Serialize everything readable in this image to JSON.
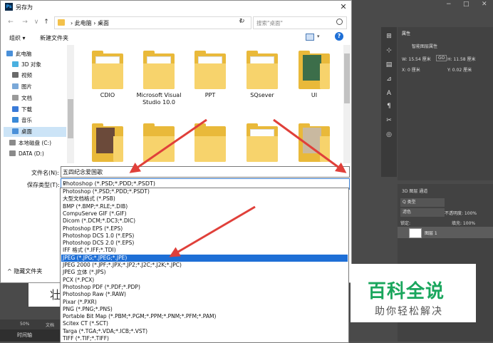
{
  "dialog": {
    "title": "另存为",
    "app_icon_text": "Ps",
    "close_glyph": "✕"
  },
  "nav": {
    "back": "←",
    "forward": "→",
    "dropdown": "∨",
    "up": "↑",
    "breadcrumb": "› 此电脑 › 桌面",
    "address_dropdown": "∨",
    "refresh": "↻",
    "search_placeholder": "搜索\"桌面\""
  },
  "toolbar": {
    "organize_label": "组织 ▾",
    "new_folder_label": "新建文件夹",
    "view_dropdown": "▾",
    "help_glyph": "?"
  },
  "sidebar": {
    "items": [
      {
        "label": "此电脑",
        "icon": "pc-icon",
        "color": "#4a90d9"
      },
      {
        "label": "3D 对象",
        "icon": "3d-objects-icon",
        "color": "#4ab0e0"
      },
      {
        "label": "视频",
        "icon": "video-icon",
        "color": "#6a6a6a"
      },
      {
        "label": "图片",
        "icon": "pictures-icon",
        "color": "#7aa8d8"
      },
      {
        "label": "文档",
        "icon": "documents-icon",
        "color": "#9a9a9a"
      },
      {
        "label": "下载",
        "icon": "downloads-icon",
        "color": "#3a7ad8"
      },
      {
        "label": "音乐",
        "icon": "music-icon",
        "color": "#3a8ad8"
      },
      {
        "label": "桌面",
        "icon": "desktop-icon",
        "color": "#4a90d9"
      },
      {
        "label": "本地磁盘 (C:)",
        "icon": "drive-icon",
        "color": "#8a8a8a"
      },
      {
        "label": "DATA (D:)",
        "icon": "drive-icon",
        "color": "#8a8a8a"
      }
    ]
  },
  "files": [
    {
      "name": "CDIO",
      "type": "folder-paper"
    },
    {
      "name": "Microsoft Visual Studio 10.0",
      "type": "folder-paper"
    },
    {
      "name": "PPT",
      "type": "folder-paper"
    },
    {
      "name": "SQsever",
      "type": "folder-paper"
    },
    {
      "name": "UI",
      "type": "folder-photo"
    },
    {
      "name": "",
      "type": "folder-photo"
    },
    {
      "name": "",
      "type": "folder-plain"
    },
    {
      "name": "",
      "type": "folder-plain"
    },
    {
      "name": "",
      "type": "folder-paper"
    },
    {
      "name": "",
      "type": "folder-paper"
    }
  ],
  "form": {
    "filename_label": "文件名(N):",
    "filename_value": "五四纪念爱国歌",
    "type_label": "保存类型(T):",
    "type_value": "Photoshop (*.PSD;*.PDD;*.PSDT)",
    "type_dropdown": "∨",
    "hide_folders": "^ 隐藏文件夹"
  },
  "type_options": [
    "Photoshop (*.PSD;*.PDD;*.PSDT)",
    "大型文档格式 (*.PSB)",
    "BMP (*.BMP;*.RLE;*.DIB)",
    "CompuServe GIF (*.GIF)",
    "Dicom (*.DCM;*.DC3;*.DIC)",
    "Photoshop EPS (*.EPS)",
    "Photoshop DCS 1.0 (*.EPS)",
    "Photoshop DCS 2.0 (*.EPS)",
    "IFF 格式 (*.IFF;*.TDI)",
    "JPEG (*.JPG;*.JPEG;*.JPE)",
    "JPEG 2000 (*.JPF;*.JPX;*.JP2;*.J2C;*.J2K;*.JPC)",
    "JPEG 立体 (*.JPS)",
    "PCX (*.PCX)",
    "Photoshop PDF (*.PDF;*.PDP)",
    "Photoshop Raw (*.RAW)",
    "Pixar (*.PXR)",
    "PNG (*.PNG;*.PNS)",
    "Portable Bit Map (*.PBM;*.PGM;*.PPM;*.PNM;*.PFM;*.PAM)",
    "Scitex CT (*.SCT)",
    "Targa (*.TGA;*.VDA;*.ICB;*.VST)",
    "TIFF (*.TIF;*.TIFF)"
  ],
  "selected_type_index": 9,
  "photoshop": {
    "canvas_char": "壮",
    "zoom": "50%",
    "doc_label": "文档",
    "timeline_label": "时间轴",
    "win_minimize": "−",
    "win_maximize": "□",
    "win_close": "✕",
    "props_tab": "属性",
    "props_title": "智能图层属性",
    "width_label": "W: 15.54 厘米",
    "go_label": "GO",
    "height_label": "H: 11.58 厘米",
    "x_label": "X: 0 厘米",
    "y_label": "Y: 0.02 厘米",
    "layers_tabs": "3D   图层   通道",
    "kind_label": "Q 类型",
    "blend_mode": "滤色",
    "opacity": "不透明度: 100%",
    "lock_label": "锁定:",
    "fill": "填充: 100%",
    "layer_name": "图层 1",
    "tools": [
      "⊞",
      "⊹",
      "▤",
      "⊿",
      "A",
      "¶",
      "✂",
      "◎"
    ]
  },
  "watermark": {
    "main": "百科全说",
    "sub": "助你轻松解决"
  },
  "colors": {
    "selection": "#1e6fd6",
    "sidebar_selected": "#cce4f7",
    "watermark_green": "#1aa65d",
    "arrow_red": "#e0403a",
    "folder_yellow": "#e9b93a"
  }
}
